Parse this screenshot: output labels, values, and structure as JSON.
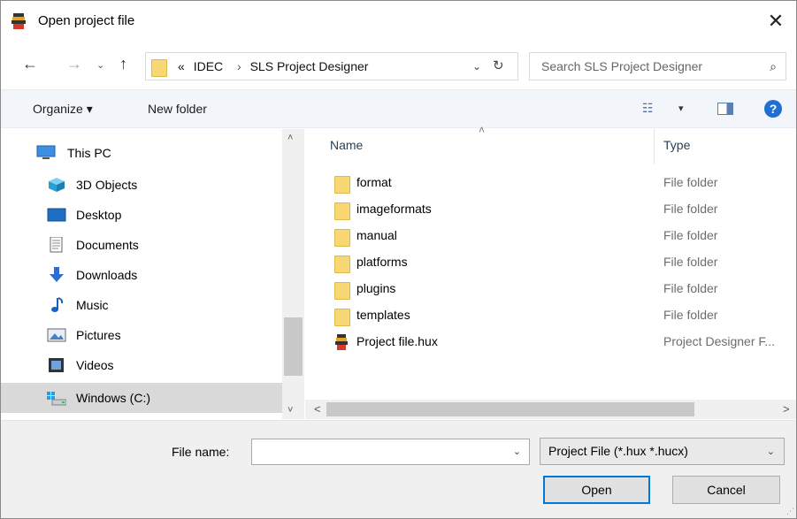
{
  "window": {
    "title": "Open project file",
    "close_glyph": "✕"
  },
  "nav": {
    "back_glyph": "←",
    "forward_glyph": "→",
    "recent_glyph": "⌄",
    "up_glyph": "↑",
    "breadcrumb": {
      "overflow": "«",
      "items": [
        "IDEC",
        "SLS Project Designer"
      ],
      "separator": "›"
    },
    "address_dropdown_glyph": "⌄",
    "refresh_glyph": "↻",
    "search_placeholder": "Search SLS Project Designer",
    "search_glyph": "⌕"
  },
  "toolbar": {
    "organize_label": "Organize ▾",
    "new_folder_label": "New folder",
    "view_glyph": "☷",
    "view_dropdown_glyph": "▾",
    "help_glyph": "?"
  },
  "sidebar": {
    "items": [
      {
        "label": "This PC",
        "icon": "pc-icon"
      },
      {
        "label": "3D Objects",
        "icon": "3d-objects-icon"
      },
      {
        "label": "Desktop",
        "icon": "desktop-icon"
      },
      {
        "label": "Documents",
        "icon": "documents-icon"
      },
      {
        "label": "Downloads",
        "icon": "downloads-icon"
      },
      {
        "label": "Music",
        "icon": "music-icon"
      },
      {
        "label": "Pictures",
        "icon": "pictures-icon"
      },
      {
        "label": "Videos",
        "icon": "videos-icon"
      },
      {
        "label": "Windows (C:)",
        "icon": "drive-icon"
      }
    ],
    "selected_index": 8,
    "scroll_up_glyph": "˄",
    "scroll_down_glyph": "˅"
  },
  "filelist": {
    "columns": [
      "Name",
      "Type"
    ],
    "sort_glyph": "˄",
    "rows": [
      {
        "name": "format",
        "type": "File folder",
        "icon": "folder-icon"
      },
      {
        "name": "imageformats",
        "type": "File folder",
        "icon": "folder-icon"
      },
      {
        "name": "manual",
        "type": "File folder",
        "icon": "folder-icon"
      },
      {
        "name": "platforms",
        "type": "File folder",
        "icon": "folder-icon"
      },
      {
        "name": "plugins",
        "type": "File folder",
        "icon": "folder-icon"
      },
      {
        "name": "templates",
        "type": "File folder",
        "icon": "folder-icon"
      },
      {
        "name": "Project file.hux",
        "type": "Project Designer F...",
        "icon": "project-file-icon"
      }
    ],
    "hscroll_left_glyph": "<",
    "hscroll_right_glyph": ">"
  },
  "footer": {
    "file_name_label": "File name:",
    "file_name_value": "",
    "file_name_dropdown_glyph": "⌄",
    "filter_value": "Project File (*.hux *.hucx)",
    "filter_dropdown_glyph": "⌄",
    "open_label": "Open",
    "cancel_label": "Cancel",
    "grip_glyph": "⋰"
  },
  "colors": {
    "accent": "#0078d7",
    "folder": "#f7d875",
    "toolbar_bg": "#f2f6fb",
    "selection": "#d9d9d9"
  }
}
